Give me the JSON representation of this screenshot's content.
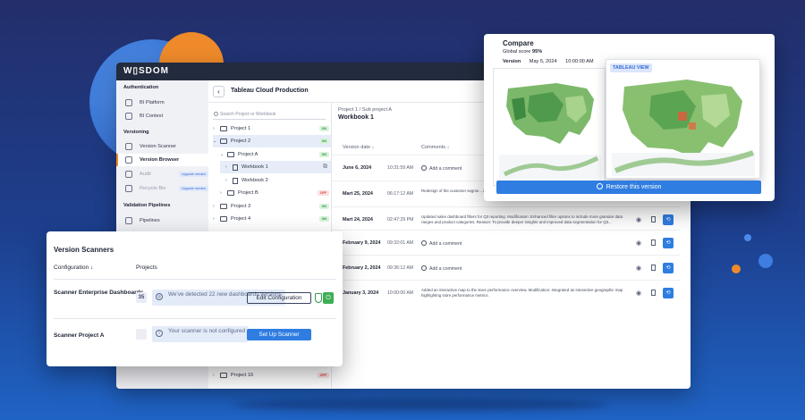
{
  "app": {
    "logo": "W▯SDOM"
  },
  "sidebar": {
    "sections": [
      {
        "title": "Authentication",
        "items": [
          {
            "label": "BI Platform"
          },
          {
            "label": "BI Context"
          }
        ]
      },
      {
        "title": "Versioning",
        "items": [
          {
            "label": "Version Scanner"
          },
          {
            "label": "Version Browser"
          },
          {
            "label": "Audit",
            "tag": "Upgrade needed"
          },
          {
            "label": "Recycle Bin",
            "tag": "Upgrade needed"
          }
        ]
      },
      {
        "title": "Validation Pipelines",
        "items": [
          {
            "label": "Pipelines"
          }
        ]
      }
    ]
  },
  "main": {
    "title": "Tableau Cloud Production",
    "search_placeholder": "Search Project or Workbook",
    "tree": [
      {
        "label": "Project 1",
        "badge": "ON",
        "status": "on"
      },
      {
        "label": "Project 2",
        "badge": "ON",
        "status": "on"
      },
      {
        "label": "Project A",
        "badge": "ON",
        "status": "on"
      },
      {
        "label": "Workbook 1",
        "badge": "",
        "status": ""
      },
      {
        "label": "Workbook 2",
        "badge": "",
        "status": ""
      },
      {
        "label": "Project B",
        "badge": "OFF",
        "status": "off"
      },
      {
        "label": "Project 3",
        "badge": "ON",
        "status": "on"
      },
      {
        "label": "Project 4",
        "badge": "ON",
        "status": "on"
      },
      {
        "label": "Project 16",
        "badge": "OFF",
        "status": "off"
      }
    ],
    "breadcrumb": "Project 1  /  Sub project A",
    "workbook": "Workbook 1",
    "columns": {
      "date": "Version date ↓",
      "comments": "Comments ↓"
    },
    "versions": [
      {
        "date": "June 6, 2024",
        "time": "10:31:59 AM",
        "comment": "",
        "add": "Add a comment"
      },
      {
        "date": "Mart 25, 2024",
        "time": "06:17:12 AM",
        "comment": "Redesign of the customer segme... improve readability and user exp...",
        "add": ""
      },
      {
        "date": "Mart 24, 2024",
        "time": "02:47:29 PM",
        "comment": "Updated sales dashboard filters for Q3 reporting. Modification: Enhanced filter options to include more granular data ranges and product categories. Reason: To provide deeper insights and improved data segmentation for Q3...",
        "add": ""
      },
      {
        "date": "February 9, 2024",
        "time": "09:32:01 AM",
        "comment": "",
        "add": "Add a comment"
      },
      {
        "date": "February 2, 2024",
        "time": "09:36:12 AM",
        "comment": "",
        "add": "Add a comment"
      },
      {
        "date": "January 3, 2024",
        "time": "10:00:00 AM",
        "comment": "Added an interactive map to the store performance overview. Modification: Integrated an interactive geographic map highlighting store performance metrics.",
        "add": ""
      }
    ]
  },
  "compare": {
    "title": "Compare",
    "score_label": "Global score",
    "score_value": "95%",
    "version_label": "Version",
    "version_date": "May 5, 2024",
    "version_time": "10:00:00 AM",
    "tab_label": "TABLEAU VIEW",
    "restore_label": "Restore this version"
  },
  "scanner": {
    "title": "Version Scanners",
    "col_config": "Configuration ↓",
    "col_projects": "Projects",
    "rows": [
      {
        "name": "Scanner Enterprise Dashboards",
        "count": "35",
        "info": "We've detected 22 new dashboards versions",
        "button": "Edit Configuration"
      },
      {
        "name": "Scanner Project A",
        "count": "",
        "info": "Your scanner is not configured",
        "button": "Set Up Scanner"
      }
    ]
  },
  "colors": {
    "accent": "#2f7de1",
    "orange": "#ee8a2a",
    "ok": "#3dae55",
    "off": "#d64545",
    "navy": "#232b3e"
  }
}
